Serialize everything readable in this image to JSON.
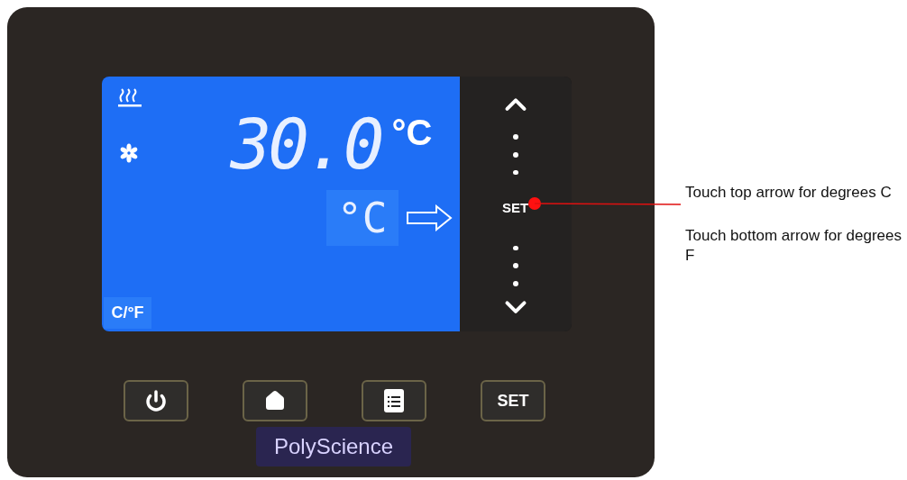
{
  "display": {
    "temperature": "30.0",
    "unit": "°C",
    "unit_option": "°C",
    "unit_toggle": "C/°F"
  },
  "touch_strip": {
    "label": "SET"
  },
  "buttons": [
    {
      "kind": "power"
    },
    {
      "kind": "home"
    },
    {
      "kind": "menu"
    },
    {
      "kind": "text",
      "label": "SET"
    }
  ],
  "brand": "PolyScience",
  "annotations": [
    "Touch top arrow for degrees C",
    "Touch bottom arrow for degrees F"
  ]
}
